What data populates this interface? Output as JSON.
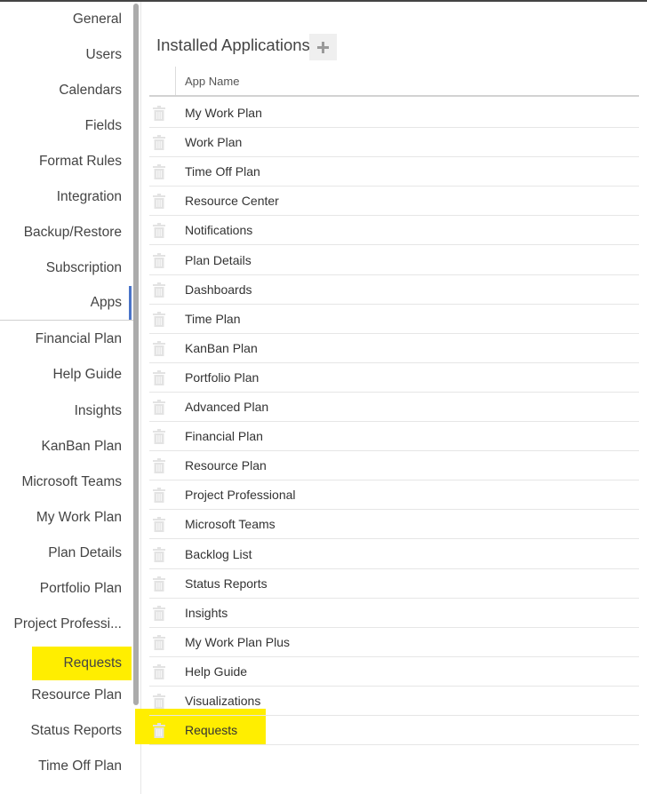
{
  "sidebar": {
    "items": [
      {
        "label": "General"
      },
      {
        "label": "Users"
      },
      {
        "label": "Calendars"
      },
      {
        "label": "Fields"
      },
      {
        "label": "Format Rules"
      },
      {
        "label": "Integration"
      },
      {
        "label": "Backup/Restore"
      },
      {
        "label": "Subscription"
      },
      {
        "label": "Apps"
      }
    ],
    "apps": [
      {
        "label": "Financial Plan"
      },
      {
        "label": "Help Guide"
      },
      {
        "label": "Insights"
      },
      {
        "label": "KanBan Plan"
      },
      {
        "label": "Microsoft Teams"
      },
      {
        "label": "My Work Plan"
      },
      {
        "label": "Plan Details"
      },
      {
        "label": "Portfolio Plan"
      },
      {
        "label": "Project Professi..."
      },
      {
        "label": "Requests"
      },
      {
        "label": "Resource Plan"
      },
      {
        "label": "Status Reports"
      },
      {
        "label": "Time Off Plan"
      }
    ],
    "selected": "Apps",
    "highlighted": "Requests"
  },
  "main": {
    "title": "Installed Applications",
    "add_icon": "plus-icon",
    "table": {
      "header": "App Name",
      "row_icon": "trash-icon",
      "rows": [
        "My Work Plan",
        "Work Plan",
        "Time Off Plan",
        "Resource Center",
        "Notifications",
        "Plan Details",
        "Dashboards",
        "Time Plan",
        "KanBan Plan",
        "Portfolio Plan",
        "Advanced Plan",
        "Financial Plan",
        "Resource Plan",
        "Project Professional",
        "Microsoft Teams",
        "Backlog List",
        "Status Reports",
        "Insights",
        "My Work Plan Plus",
        "Help Guide",
        "Visualizations",
        "Requests"
      ],
      "highlighted_row": "Requests"
    }
  },
  "colors": {
    "highlight": "#ffee00",
    "selected_accent": "#4a74c9"
  }
}
